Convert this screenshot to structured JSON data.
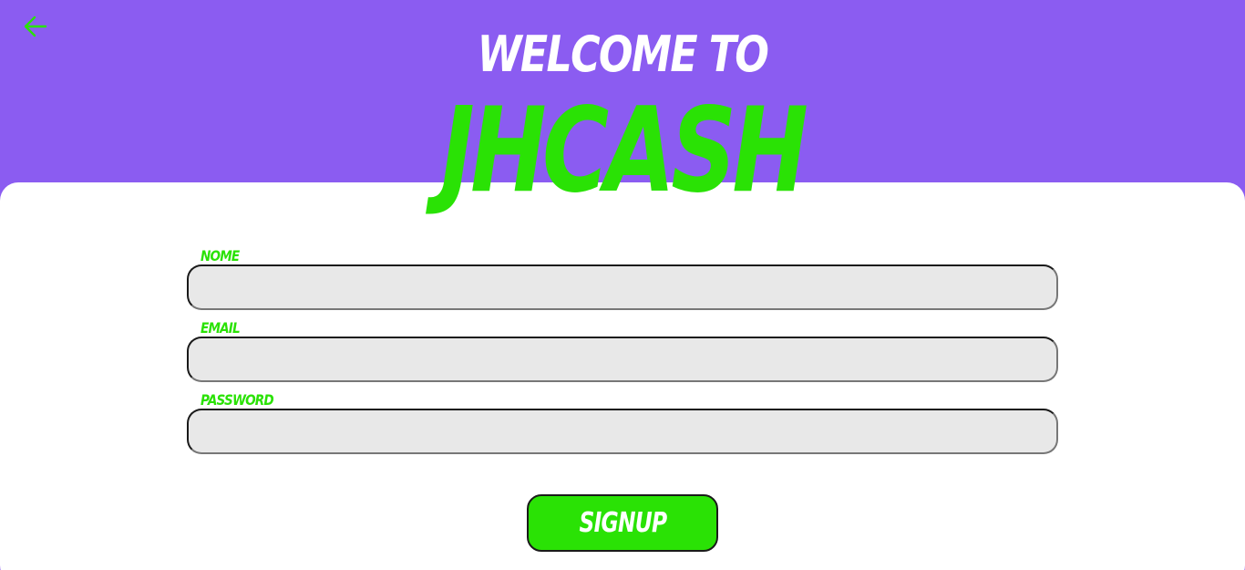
{
  "header": {
    "back_icon": "arrow-left-icon",
    "welcome_text": "WELCOME TO",
    "brand_name": "JHCASH"
  },
  "form": {
    "fields": [
      {
        "label": "NOME",
        "value": "",
        "placeholder": ""
      },
      {
        "label": "EMAIL",
        "value": "",
        "placeholder": ""
      },
      {
        "label": "PASSWORD",
        "value": "",
        "placeholder": ""
      }
    ],
    "submit_label": "SIGNUP"
  },
  "colors": {
    "background": "#8b5cf1",
    "accent": "#2ae205",
    "card": "#ffffff",
    "input_bg": "#e8e8e8"
  }
}
